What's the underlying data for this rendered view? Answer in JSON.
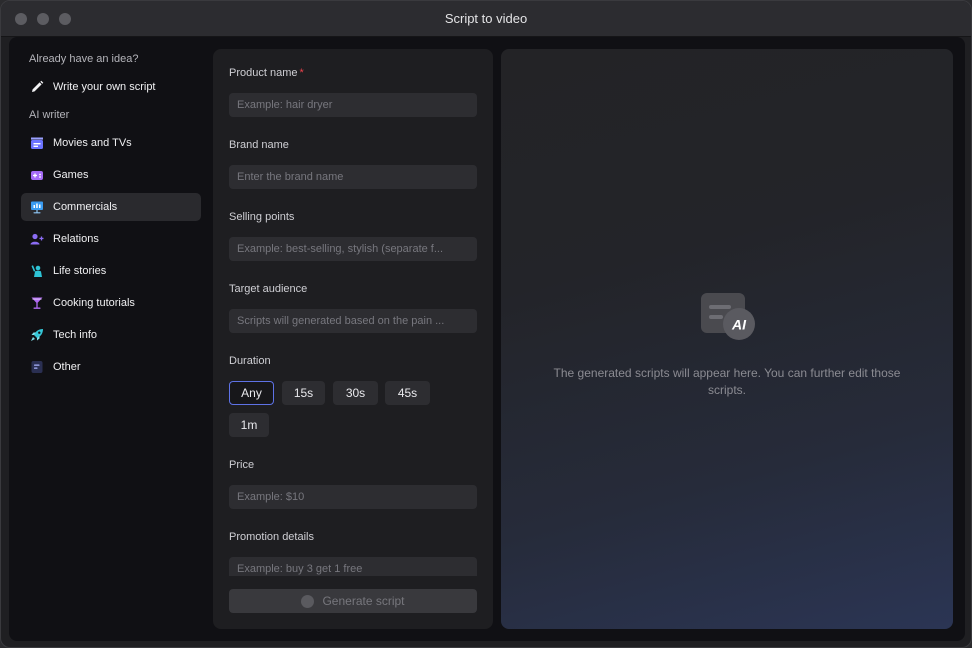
{
  "window": {
    "title": "Script to video"
  },
  "sidebar": {
    "own_section_label": "Already have an idea?",
    "write_own": {
      "label": "Write your own script",
      "icon": "pencil-icon"
    },
    "ai_section_label": "AI writer",
    "items": [
      {
        "label": "Movies and TVs",
        "icon": "clapperboard-icon",
        "color": "#6b73ff",
        "active": false
      },
      {
        "label": "Games",
        "icon": "gamepad-icon",
        "color": "#a56bf5",
        "active": false
      },
      {
        "label": "Commercials",
        "icon": "presentation-icon",
        "color": "#3a9bf0",
        "active": true
      },
      {
        "label": "Relations",
        "icon": "people-icon",
        "color": "#8b6cf4",
        "active": false
      },
      {
        "label": "Life stories",
        "icon": "person-wave-icon",
        "color": "#2ec4d6",
        "active": false
      },
      {
        "label": "Cooking tutorials",
        "icon": "cocktail-icon",
        "color": "#b06af2",
        "active": false
      },
      {
        "label": "Tech info",
        "icon": "rocket-icon",
        "color": "#35c7d8",
        "active": false
      },
      {
        "label": "Other",
        "icon": "document-lines-icon",
        "color": "#5d6fd6",
        "active": false
      }
    ]
  },
  "form": {
    "product_name": {
      "label": "Product name",
      "required_mark": "*",
      "placeholder": "Example: hair dryer",
      "value": ""
    },
    "brand_name": {
      "label": "Brand name",
      "placeholder": "Enter the brand name",
      "value": ""
    },
    "selling_points": {
      "label": "Selling points",
      "placeholder": "Example: best-selling, stylish (separate f...",
      "value": ""
    },
    "target_audience": {
      "label": "Target audience",
      "placeholder": "Scripts will generated based on the pain ...",
      "value": ""
    },
    "duration": {
      "label": "Duration",
      "options": [
        "Any",
        "15s",
        "30s",
        "45s",
        "1m"
      ],
      "selected": "Any"
    },
    "price": {
      "label": "Price",
      "placeholder": "Example: $10",
      "value": ""
    },
    "promotion_details": {
      "label": "Promotion details",
      "placeholder": "Example: buy 3 get 1 free",
      "value": ""
    },
    "generate_label": "Generate script"
  },
  "result": {
    "empty_icon": "ai-document-icon",
    "empty_message": "The generated scripts will appear here. You can further edit those scripts."
  },
  "colors": {
    "accent": "#5e72e6",
    "required": "#e9414b"
  }
}
